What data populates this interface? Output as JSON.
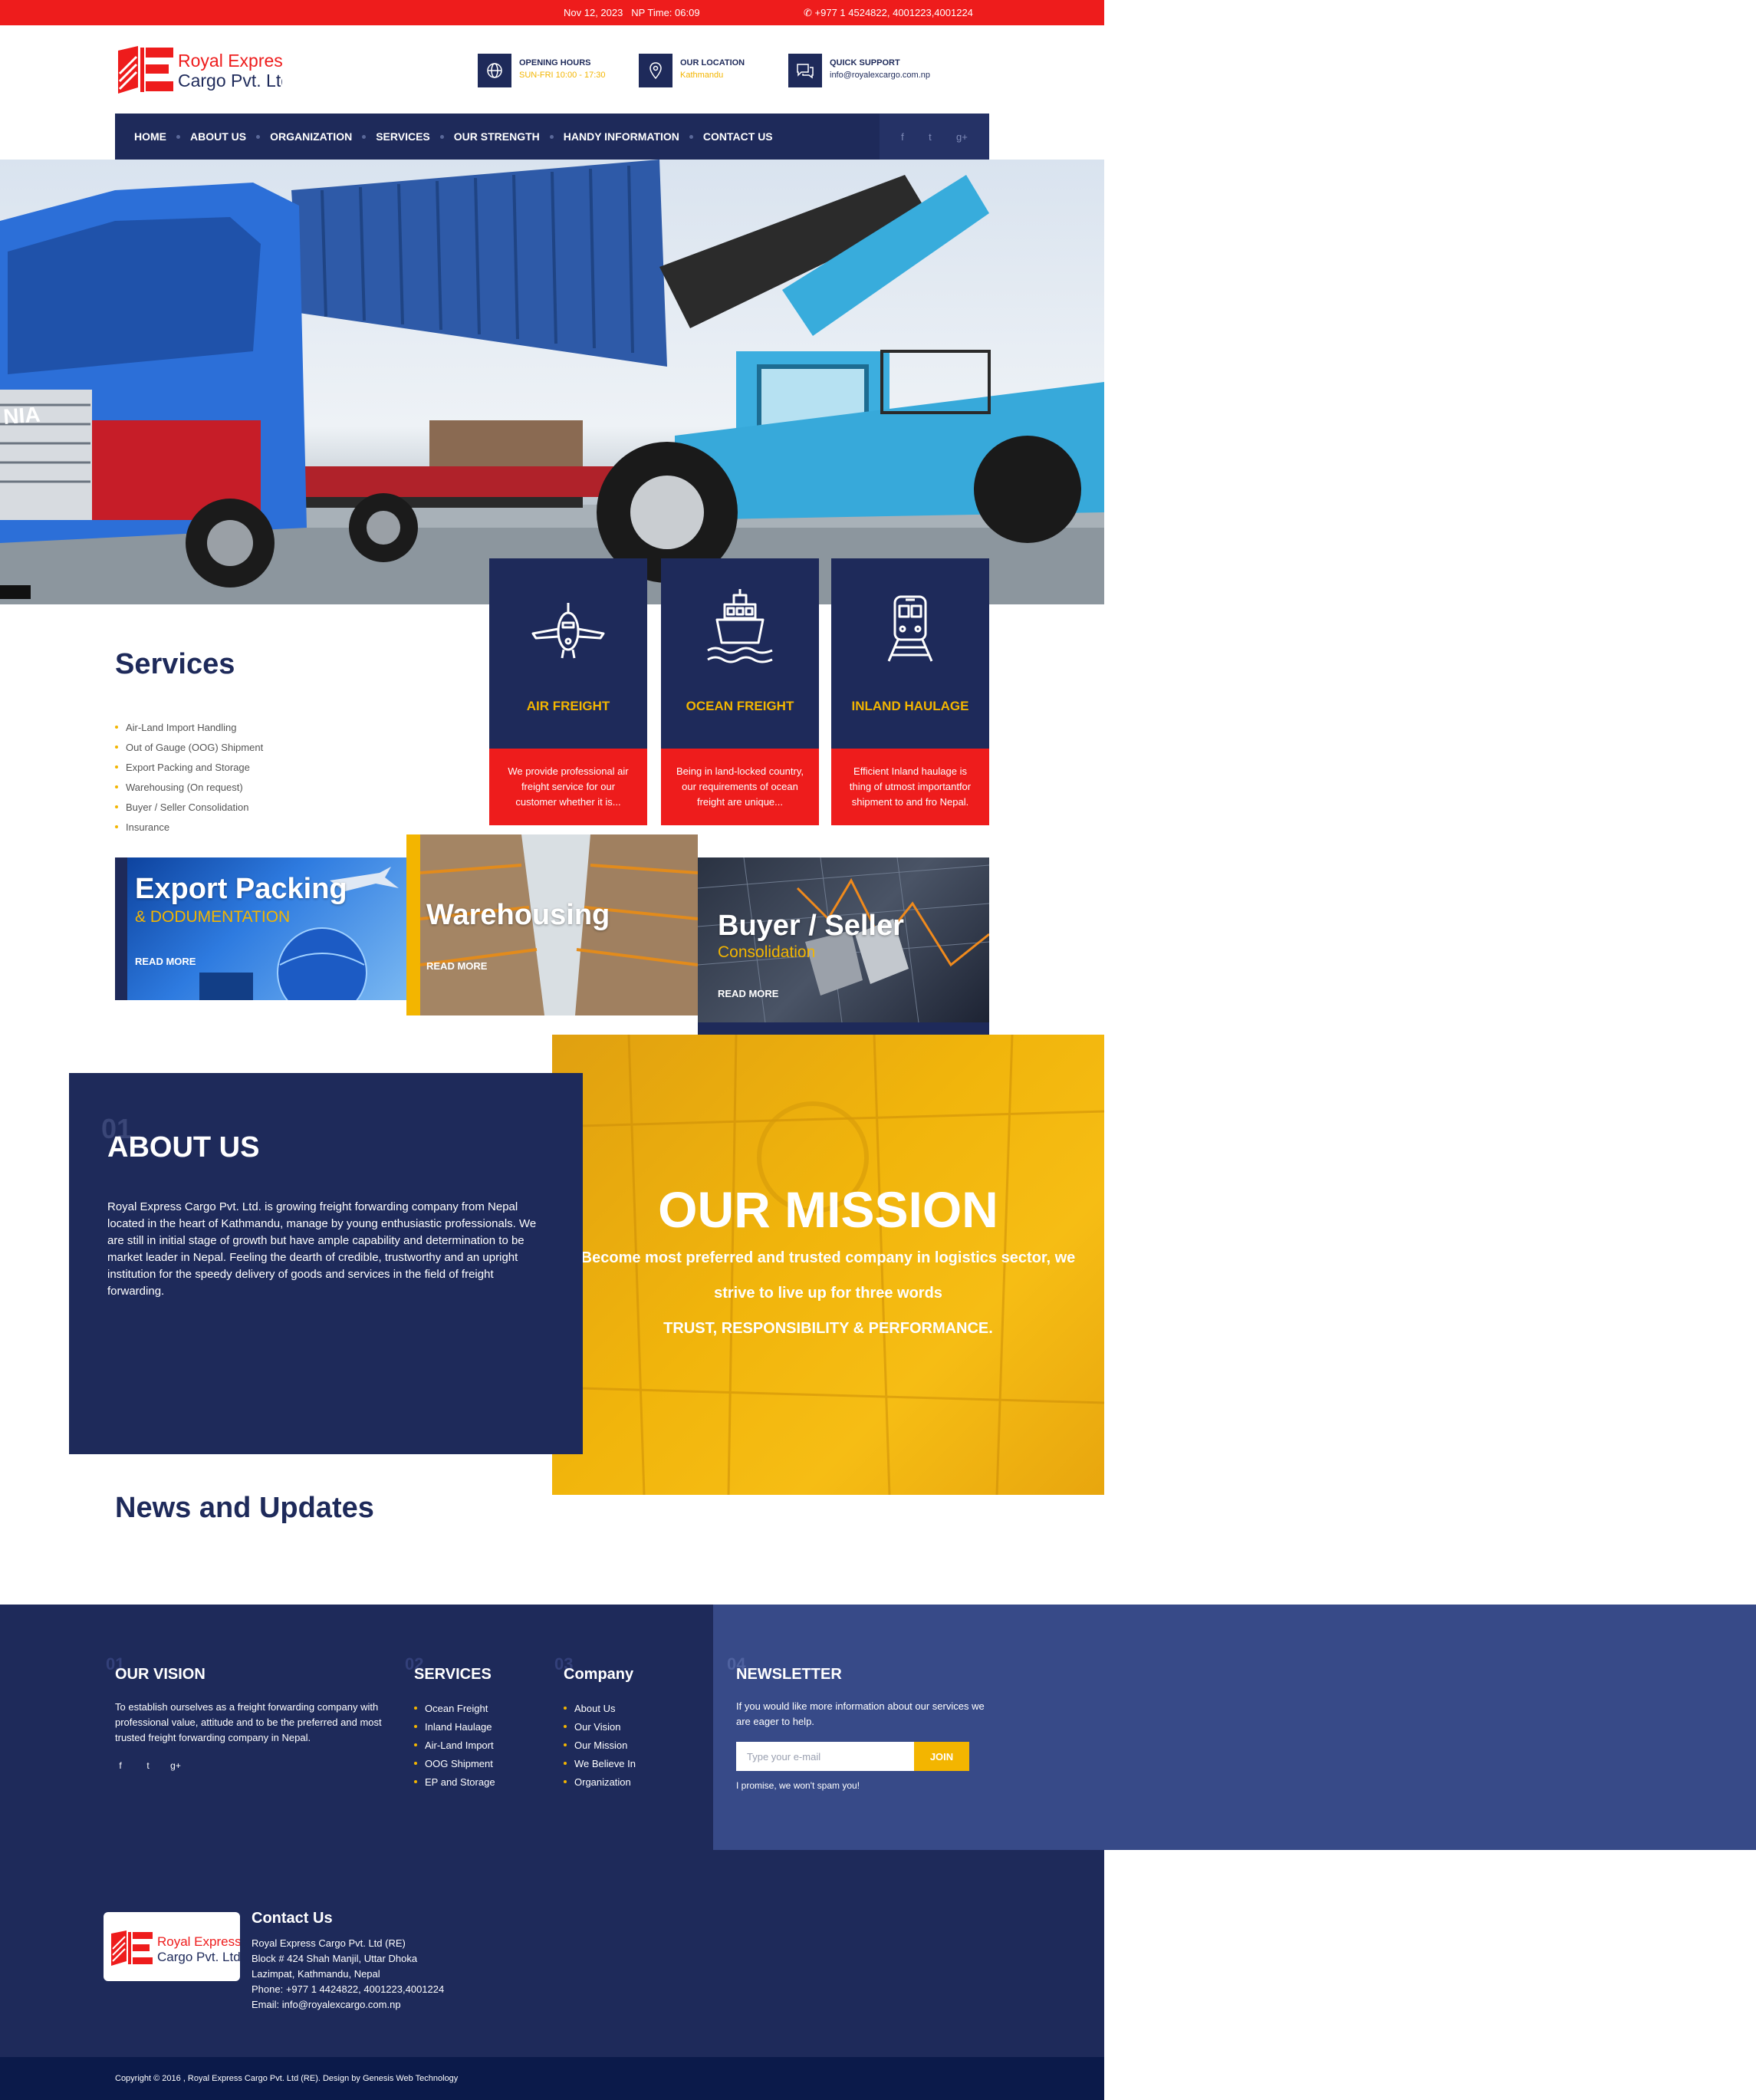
{
  "topbar": {
    "date": "Nov 12, 2023",
    "np_time": "NP Time: 06:09",
    "phone": "+977 1 4524822, 4001223,4001224"
  },
  "brand": {
    "logo_line1": "Royal Express",
    "logo_line2": "Cargo Pvt. Ltd",
    "colors": {
      "navy": "#1e2a5a",
      "red": "#ee1c1c",
      "yellow": "#f3b500"
    }
  },
  "header_info": [
    {
      "icon": "globe-icon",
      "label": "OPENING HOURS",
      "value": "SUN-FRI 10:00 - 17:30"
    },
    {
      "icon": "location-pin-icon",
      "label": "OUR LOCATION",
      "value": "Kathmandu"
    },
    {
      "icon": "chat-icon",
      "label": "QUICK SUPPORT",
      "value": "info@royalexcargo.com.np"
    }
  ],
  "nav": {
    "items": [
      "HOME",
      "ABOUT US",
      "ORGANIZATION",
      "SERVICES",
      "OUR STRENGTH",
      "HANDY INFORMATION",
      "CONTACT US"
    ],
    "social": [
      "f",
      "t",
      "g+"
    ]
  },
  "services": {
    "title": "Services",
    "list": [
      "Air-Land Import Handling",
      "Out of Gauge (OOG) Shipment",
      "Export Packing and Storage",
      "Warehousing (On request)",
      "Buyer / Seller Consolidation",
      "Insurance"
    ],
    "cards": [
      {
        "icon": "airplane-icon",
        "title": "AIR FREIGHT",
        "text": "We provide professional air freight service for our customer whether it is..."
      },
      {
        "icon": "ship-icon",
        "title": "OCEAN FREIGHT",
        "text": "Being in land-locked country, our requirements of ocean freight are unique..."
      },
      {
        "icon": "train-icon",
        "title": "INLAND HAULAGE",
        "text": "Efficient Inland haulage is thing of utmost importantfor shipment to and fro Nepal."
      }
    ],
    "tiles": [
      {
        "title": "Export Packing",
        "subtitle": "& DODUMENTATION",
        "more": "READ MORE"
      },
      {
        "title": "Warehousing",
        "subtitle": "",
        "more": "READ MORE"
      },
      {
        "title": "Buyer / Seller",
        "subtitle": "Consolidation",
        "more": "READ MORE"
      }
    ]
  },
  "about": {
    "num": "01",
    "title": "ABOUT US",
    "body": "Royal Express Cargo Pvt. Ltd. is growing freight forwarding company from Nepal located in the heart of Kathmandu, manage by young enthusiastic professionals. We are still in initial stage of growth but have ample capability and determination to be market leader in Nepal. Feeling the dearth of credible, trustworthy and an upright institution for the speedy delivery of goods and services in the field of freight forwarding."
  },
  "mission": {
    "title": "OUR MISSION",
    "line1": "Become most preferred and trusted company in logistics sector, we",
    "line2": "strive to live up for three words",
    "line3": "TRUST, RESPONSIBILITY & PERFORMANCE."
  },
  "news": {
    "title": "News and Updates"
  },
  "footer": {
    "vision": {
      "num": "01",
      "title": "OUR VISION",
      "text": "To establish ourselves as a freight forwarding company with professional value, attitude and to be the preferred and most trusted freight forwarding company in Nepal."
    },
    "services": {
      "num": "02",
      "title": "SERVICES",
      "items": [
        "Ocean Freight",
        "Inland Haulage",
        "Air-Land Import",
        "OOG Shipment",
        "EP and Storage"
      ]
    },
    "company": {
      "num": "03",
      "title": "Company",
      "items": [
        "About Us",
        "Our Vision",
        "Our Mission",
        "We Believe In",
        "Organization"
      ]
    },
    "newsletter": {
      "num": "04",
      "title": "NEWSLETTER",
      "text": "If you would like more information about our services we are eager to help.",
      "placeholder": "Type your e-mail",
      "button": "JOIN",
      "note": "I promise, we won't spam you!"
    },
    "contact": {
      "title": "Contact Us",
      "lines": [
        "Royal Express Cargo Pvt. Ltd (RE)",
        "Block # 424 Shah Manjil, Uttar Dhoka",
        "Lazimpat, Kathmandu, Nepal",
        "Phone: +977 1 4424822, 4001223,4001224",
        "Email: info@royalexcargo.com.np"
      ]
    },
    "copyright": "Copyright © 2016 , Royal Express Cargo Pvt. Ltd (RE). Design by Genesis Web Technology"
  }
}
